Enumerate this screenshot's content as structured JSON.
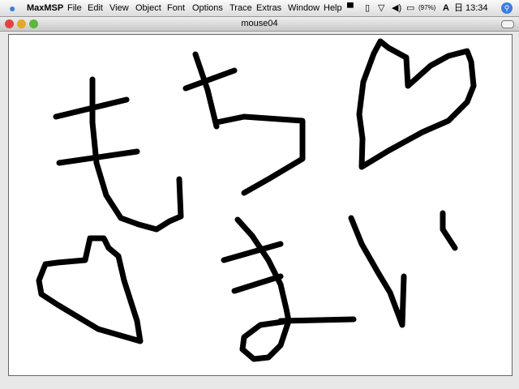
{
  "menubar": {
    "apple_icon": "apple-icon",
    "app": "MaxMSP",
    "items": [
      "File",
      "Edit",
      "View",
      "Object",
      "Font",
      "Options",
      "Trace",
      "Extras",
      "Window",
      "Help"
    ],
    "status": {
      "battery": "(97%)",
      "input_method": "A",
      "calendar_glyph": "日",
      "clock": "13:34",
      "spotlight_icon": "spotlight-icon"
    }
  },
  "window": {
    "title": "mouse04",
    "traffic_colors": {
      "close": "#e0443e",
      "minimize": "#e6a72a",
      "zoom": "#5ab83a"
    }
  }
}
